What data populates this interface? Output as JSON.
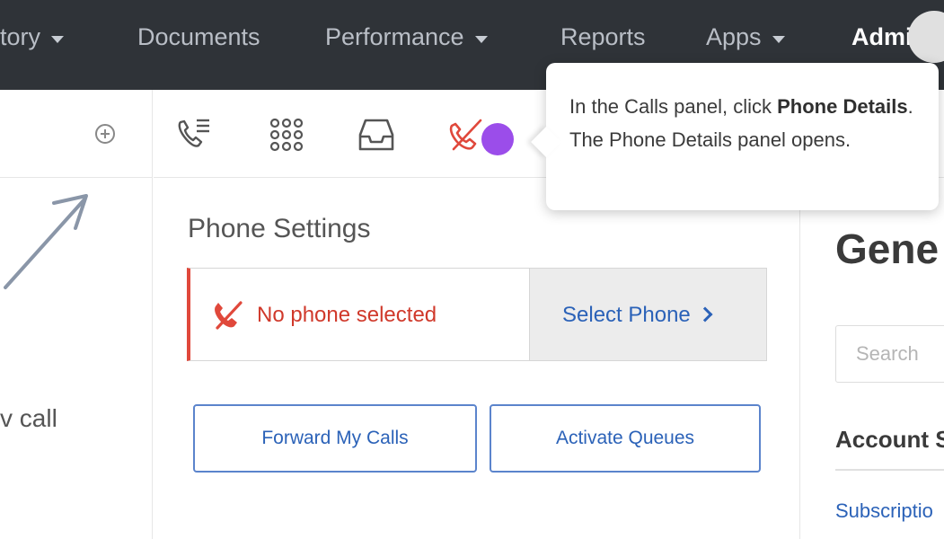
{
  "nav": {
    "items": [
      {
        "label": "tory",
        "dropdown": true
      },
      {
        "label": "Documents",
        "dropdown": false
      },
      {
        "label": "Performance",
        "dropdown": true
      },
      {
        "label": "Reports",
        "dropdown": false
      },
      {
        "label": "Apps",
        "dropdown": true
      },
      {
        "label": "Admin",
        "dropdown": false
      }
    ]
  },
  "left_panel": {
    "partial_text": "v call",
    "add_icon": "add-circle-icon"
  },
  "toolbar": {
    "icons": [
      "phone-list-icon",
      "dialpad-icon",
      "inbox-icon",
      "phone-disconnected-icon"
    ]
  },
  "tooltip": {
    "text_before": "In the Calls panel, click ",
    "bold": "Phone Details",
    "text_after": ". The Phone Details panel opens."
  },
  "phone_settings": {
    "title": "Phone Settings",
    "status": "No phone selected",
    "select_label": "Select Phone",
    "forward_label": "Forward My Calls",
    "queues_label": "Activate Queues"
  },
  "right_panel": {
    "title": "Gene",
    "search_placeholder": "Search",
    "section_title": "Account S",
    "link": "Subscriptio"
  },
  "colors": {
    "nav_bg": "#2f3338",
    "accent_blue": "#2b62b8",
    "error_red": "#d0392b",
    "highlight_purple": "#9b4dea"
  }
}
